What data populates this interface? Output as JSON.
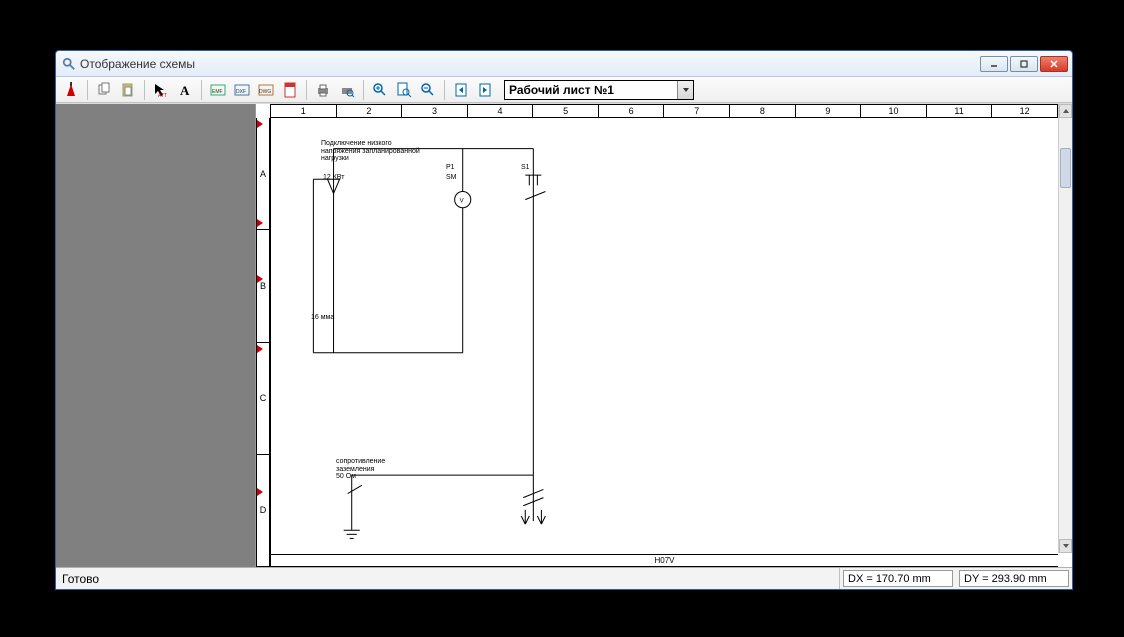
{
  "window": {
    "title": "Отображение схемы"
  },
  "toolbar": {
    "sheet_label": "Рабочий лист №1"
  },
  "ruler": {
    "cols": [
      "1",
      "2",
      "3",
      "4",
      "5",
      "6",
      "7",
      "8",
      "9",
      "10",
      "11",
      "12"
    ],
    "rows": [
      "A",
      "B",
      "C",
      "D"
    ]
  },
  "schematic": {
    "text_top": "Подключение низкого\nнапряжения запланированной\nнагрузки",
    "label_12kw": "12 КВт",
    "label_P1": "P1",
    "label_SM": "SM",
    "label_S1": "S1",
    "label_16mma": "16 мма",
    "text_ground": "сопротивление\nзаземления\n50 Ом",
    "footer": "H07V"
  },
  "status": {
    "ready": "Готово",
    "dx": "DX = 170.70 mm",
    "dy": "DY = 293.90 mm"
  }
}
